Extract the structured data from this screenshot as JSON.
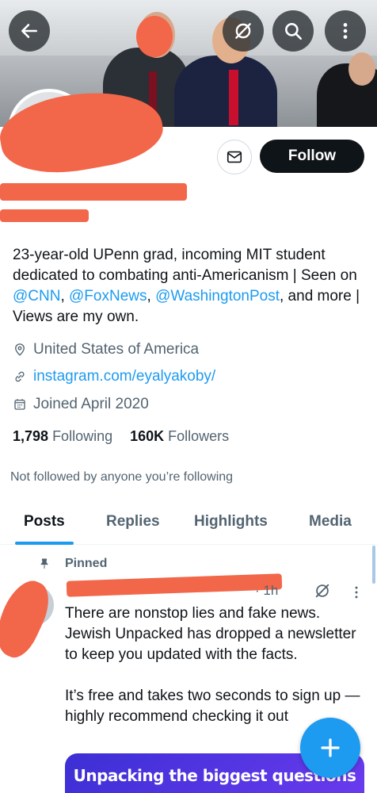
{
  "header": {
    "back_icon": "arrow-left-icon",
    "grok_icon": "slash-circle-icon",
    "search_icon": "search-icon",
    "more_icon": "more-vertical-icon"
  },
  "profile": {
    "display_name": "",
    "handle": "",
    "bio_parts": [
      "23-year-old UPenn grad, incoming MIT student dedicated to combating anti-Americanism | Seen on ",
      "@CNN",
      ", ",
      "@FoxNews",
      ", ",
      "@WashingtonPost",
      ", and more | Views are my own."
    ],
    "location": "United States of America",
    "website": "instagram.com/eyalyakoby/",
    "joined": "Joined April 2020",
    "following_count": "1,798",
    "following_label": "Following",
    "followers_count": "160K",
    "followers_label": "Followers",
    "not_followed": "Not followed by anyone you’re following"
  },
  "actions": {
    "message_icon": "envelope-icon",
    "follow_label": "Follow"
  },
  "tabs": [
    {
      "label": "Posts",
      "active": true
    },
    {
      "label": "Replies",
      "active": false
    },
    {
      "label": "Highlights",
      "active": false
    },
    {
      "label": "Media",
      "active": false
    }
  ],
  "post": {
    "pinned_label": "Pinned",
    "time": "· 1h",
    "text": "There are nonstop lies and fake news. Jewish Unpacked has dropped a newsletter to keep you updated with the facts.\n\nIt’s free and takes two seconds to sign up — highly recommend checking it out",
    "card_text": "Unpacking the biggest questions"
  },
  "colors": {
    "accent": "#1d9bf0",
    "text": "#0f1419",
    "secondary": "#536471",
    "redaction": "#f2664a"
  }
}
